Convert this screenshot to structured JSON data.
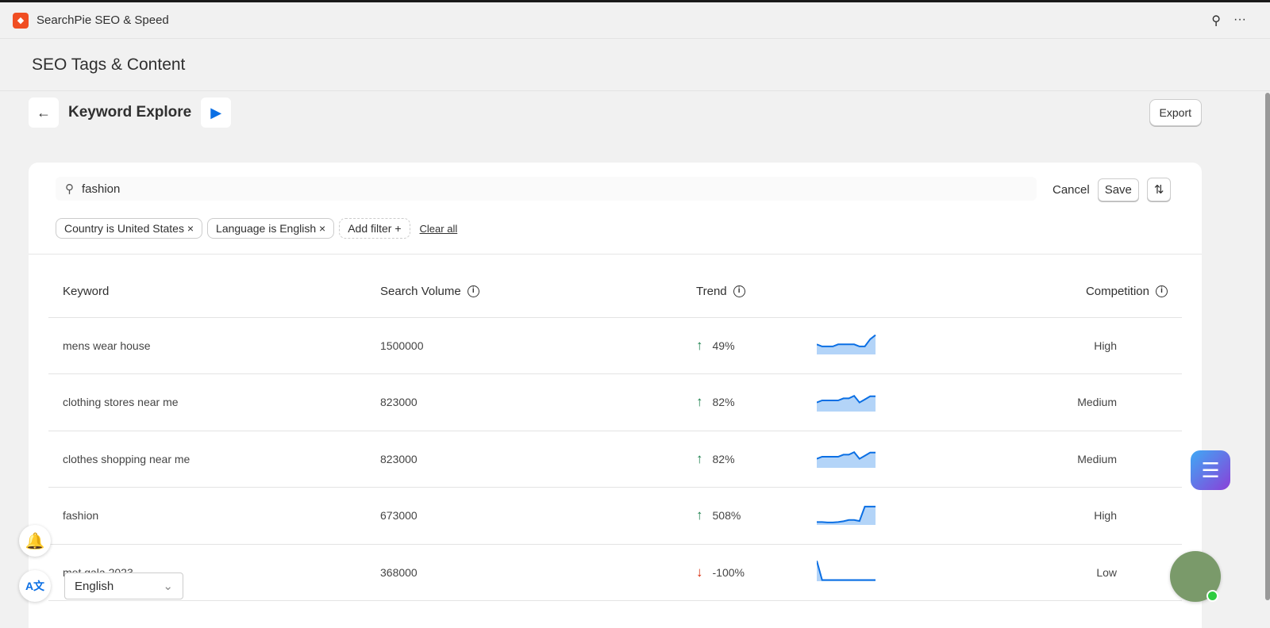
{
  "app": {
    "title": "SearchPie SEO & Speed",
    "page_title": "SEO Tags & Content",
    "subtitle": "Keyword Explore",
    "export_label": "Export"
  },
  "search": {
    "value": "fashion",
    "cancel": "Cancel",
    "save": "Save"
  },
  "filters": [
    {
      "label": "Country is United States ×"
    },
    {
      "label": "Language is English ×"
    },
    {
      "label": "Add filter +"
    }
  ],
  "clear_all": "Clear all",
  "columns": {
    "keyword": "Keyword",
    "volume": "Search Volume",
    "trend": "Trend",
    "competition": "Competition"
  },
  "rows": [
    {
      "keyword": "mens wear house",
      "volume": "1500000",
      "dir": "up",
      "trend": "49%",
      "competition": "High",
      "spark": [
        0.45,
        0.35,
        0.35,
        0.35,
        0.45,
        0.45,
        0.45,
        0.45,
        0.35,
        0.35,
        0.7,
        0.9
      ]
    },
    {
      "keyword": "clothing stores near me",
      "volume": "823000",
      "dir": "up",
      "trend": "82%",
      "competition": "Medium",
      "spark": [
        0.4,
        0.5,
        0.5,
        0.5,
        0.5,
        0.6,
        0.6,
        0.72,
        0.4,
        0.55,
        0.7,
        0.7
      ]
    },
    {
      "keyword": "clothes shopping near me",
      "volume": "823000",
      "dir": "up",
      "trend": "82%",
      "competition": "Medium",
      "spark": [
        0.4,
        0.5,
        0.5,
        0.5,
        0.5,
        0.6,
        0.6,
        0.72,
        0.4,
        0.55,
        0.7,
        0.7
      ]
    },
    {
      "keyword": "fashion",
      "volume": "673000",
      "dir": "up",
      "trend": "508%",
      "competition": "High",
      "spark": [
        0.1,
        0.1,
        0.08,
        0.08,
        0.1,
        0.14,
        0.2,
        0.2,
        0.15,
        0.85,
        0.85,
        0.85
      ]
    },
    {
      "keyword": "met gala 2023",
      "volume": "368000",
      "dir": "down",
      "trend": "-100%",
      "competition": "Low",
      "spark": [
        0.95,
        0.02,
        0.02,
        0.02,
        0.02,
        0.02,
        0.02,
        0.02,
        0.02,
        0.02,
        0.02,
        0.02
      ]
    }
  ],
  "language": {
    "value": "English"
  },
  "colors": {
    "brand": "#f04e23",
    "accent": "#0b6fe4",
    "up": "#1a7f4b",
    "down": "#d82c0d"
  }
}
